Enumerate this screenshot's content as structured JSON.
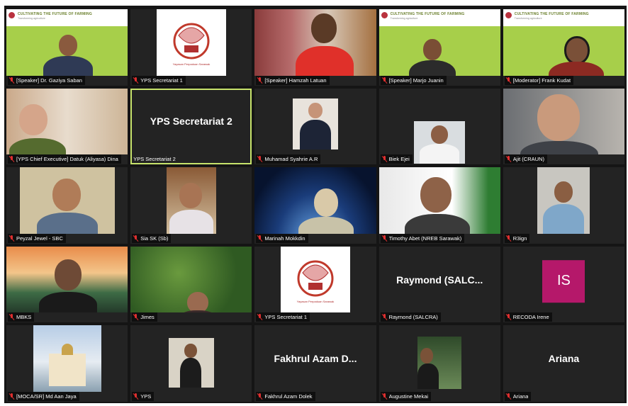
{
  "slide": {
    "title": "CULTIVATING THE FUTURE OF FARMING",
    "subtitle": "Transforming agriculture"
  },
  "tiles": [
    {
      "name": "[Speaker] Dr. Gaziya Saban"
    },
    {
      "name": "YPS Secretariat 1"
    },
    {
      "name": "[Speaker] Hamzah Latuan"
    },
    {
      "name": "[Speaker] Marjo Juanin"
    },
    {
      "name": "[Moderator] Frank Kudat"
    },
    {
      "name": "[YPS Chief Executive] Datuk (Aliyasa) Dina"
    },
    {
      "name": "YPS Secretariat 2",
      "display": "YPS Secretariat 2"
    },
    {
      "name": "Muhamad Syahrie A.R"
    },
    {
      "name": "Biek Ejei"
    },
    {
      "name": "Ajit (CRAUN)"
    },
    {
      "name": "Peyzal Jewel - SBC"
    },
    {
      "name": "Sia SK (Sb)"
    },
    {
      "name": "Marinah Mokkdin"
    },
    {
      "name": "Timothy Abet (NREB Sarawak)"
    },
    {
      "name": "R3ign"
    },
    {
      "name": "MBKS"
    },
    {
      "name": "Jimes"
    },
    {
      "name": "YPS Secretariat 1"
    },
    {
      "name": "Raymond (SALCRA)",
      "display": "Raymond  (SALC..."
    },
    {
      "name": "RECODA Irene",
      "initials": "IS"
    },
    {
      "name": "[MOCA/SR] Md Aan Jaya"
    },
    {
      "name": "YPS"
    },
    {
      "name": "Fakhrul Azam Dolek",
      "display": "Fakhrul Azam D..."
    },
    {
      "name": "Augustine Mekai"
    },
    {
      "name": "Ariana",
      "display": "Ariana"
    }
  ]
}
